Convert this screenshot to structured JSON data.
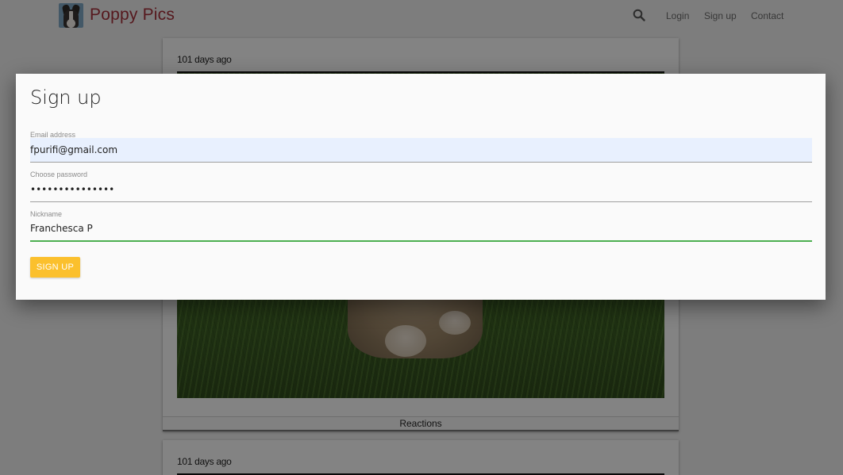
{
  "header": {
    "brand": "Poppy Pics",
    "nav": {
      "login": "Login",
      "signup": "Sign up",
      "contact": "Contact"
    },
    "search_icon": "search-icon",
    "logo_icon": "puppy-logo-icon",
    "brand_color": "#a3303a"
  },
  "feed": {
    "cards": [
      {
        "time": "101 days ago",
        "reactions_label": "Reactions"
      },
      {
        "time": "101 days ago"
      }
    ]
  },
  "modal": {
    "title": "Sign up",
    "email": {
      "label": "Email address",
      "value": "fpurifi@gmail.com"
    },
    "password": {
      "label": "Choose password",
      "value": "•••••••••••••••"
    },
    "nickname": {
      "label": "Nickname",
      "value": "Franchesca P"
    },
    "submit_label": "SIGN UP",
    "submit_color": "#fbc02d",
    "focus_color": "#4caf50"
  }
}
